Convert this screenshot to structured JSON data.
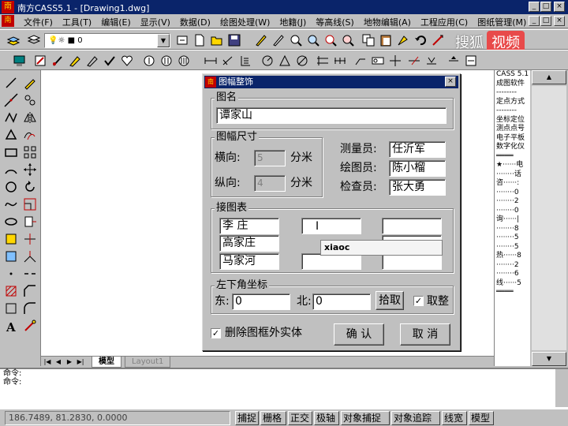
{
  "window": {
    "title": "南方CASS5.1 - [Drawing1.dwg]",
    "app_icon_glyph": "南",
    "doc_icon_glyph": "南"
  },
  "menu": [
    "文件(F)",
    "工具(T)",
    "编辑(E)",
    "显示(V)",
    "数据(D)",
    "绘图处理(W)",
    "地籍(J)",
    "等高线(S)",
    "地物编辑(A)",
    "工程应用(C)",
    "图纸管理(M)"
  ],
  "toolbar": {
    "layer_value": "0"
  },
  "watermark": {
    "text": "搜狐",
    "badge": "视频"
  },
  "right_panel": [
    "CASS 5.1",
    "成图软件",
    "--------",
    "定点方式",
    "--------",
    "坐标定位",
    "测点点号",
    "电子平板",
    "数字化仪",
    "════",
    "★······电",
    "········话",
    "咨······:",
    "········0",
    "········2",
    "········0",
    "询······|",
    "········8",
    "········5",
    "········5",
    "热······8",
    "········2",
    "········6",
    "线······5",
    "════"
  ],
  "layout_tabs": {
    "model": "模型",
    "layout1": "Layout1"
  },
  "command": {
    "line1": "命令:",
    "line2": "命令:"
  },
  "status": {
    "coords": "186.7489, 81.2830, 0.0000",
    "buttons": [
      "捕捉",
      "栅格",
      "正交",
      "极轴",
      "对象捕捉",
      "对象追踪",
      "线宽",
      "模型"
    ]
  },
  "dialog": {
    "title": "图幅整饰",
    "map_name_label": "图名",
    "map_name_value": "谭家山",
    "size_label": "图幅尺寸",
    "width_label": "横向:",
    "width_value": "5",
    "height_label": "纵向:",
    "height_value": "4",
    "unit": "分米",
    "surveyor_label": "测量员:",
    "surveyor_value": "任沂军",
    "drafter_label": "绘图员:",
    "drafter_value": "陈小榴",
    "checker_label": "检查员:",
    "checker_value": "张大勇",
    "adjacent_label": "接图表",
    "adjacent": [
      "李 庄",
      "",
      "",
      "高家庄",
      "",
      "马家河",
      "",
      ""
    ],
    "autocomplete": "xiaoc",
    "corner_label": "左下角坐标",
    "east_label": "东:",
    "east_value": "0",
    "north_label": "北:",
    "north_value": "0",
    "pick_button": "拾取",
    "snap_label": "取整",
    "delete_label": "删除图框外实体",
    "ok_button": "确 认",
    "cancel_button": "取 消"
  }
}
